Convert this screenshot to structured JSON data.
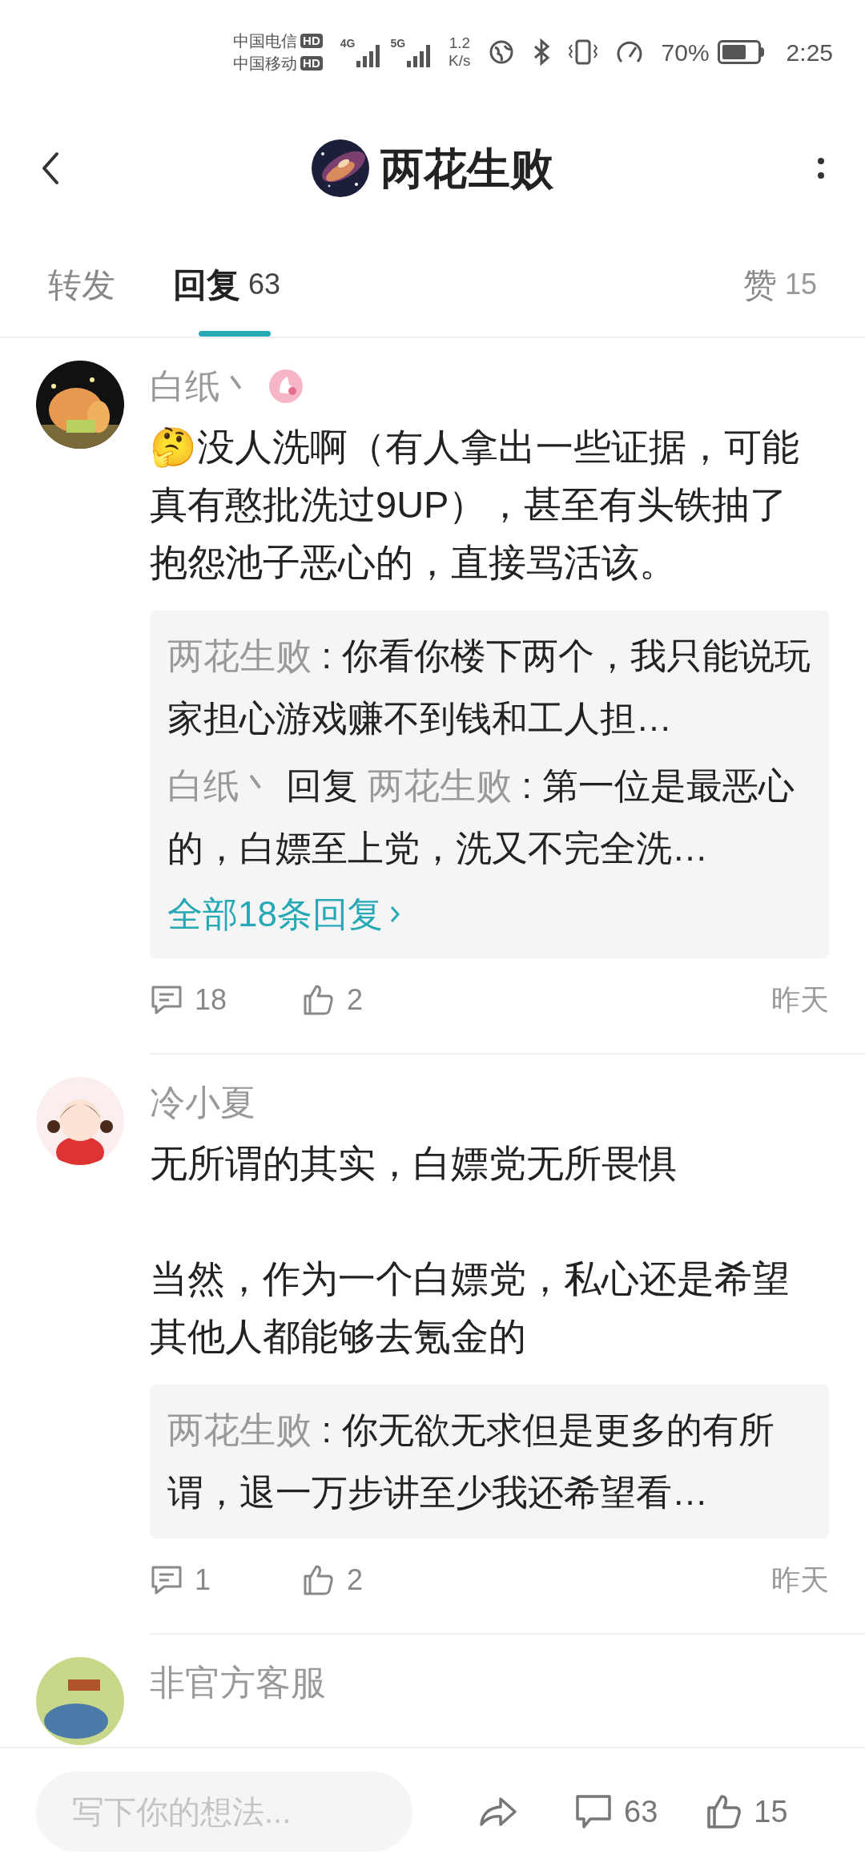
{
  "status_bar": {
    "carriers": [
      {
        "name": "中国电信",
        "badge": "HD"
      },
      {
        "name": "中国移动",
        "badge": "HD"
      }
    ],
    "signals": [
      {
        "label": "4G"
      },
      {
        "label": "5G"
      }
    ],
    "speed": {
      "value": "1.2",
      "unit": "K/s"
    },
    "battery": {
      "text": "70%"
    },
    "time": "2:25"
  },
  "header": {
    "title": "两花生败"
  },
  "tabs": [
    {
      "label": "转发",
      "selected": false
    },
    {
      "label": "回复",
      "count": "63",
      "selected": true
    },
    {
      "label": "赞",
      "count": "15",
      "selected": false
    }
  ],
  "comments": [
    {
      "user": "白纸丶",
      "has_badge": true,
      "paragraphs": [
        "🤔没人洗啊（有人拿出一些证据，可能真有憨批洗过9UP），甚至有头铁抽了抱怨池子恶心的，直接骂活该。"
      ],
      "replies": [
        {
          "author": "两花生败",
          "colon": ":",
          "text": "你看你楼下两个，我只能说玩家担心游戏赚不到钱和工人担…"
        },
        {
          "author": "白纸丶",
          "reply_word": "回复",
          "reply_to": "两花生败",
          "colon": ":",
          "text": "第一位是最恶心的，白嫖至上党，洗又不完全洗…"
        }
      ],
      "more_link": "全部18条回复",
      "reply_count": "18",
      "like_count": "2",
      "time": "昨天"
    },
    {
      "user": "冷小夏",
      "has_badge": false,
      "paragraphs": [
        "无所谓的其实，白嫖党无所畏惧",
        "当然，作为一个白嫖党，私心还是希望其他人都能够去氪金的"
      ],
      "replies": [
        {
          "author": "两花生败",
          "colon": ":",
          "text": "你无欲无求但是更多的有所谓，退一万步讲至少我还希望看…"
        }
      ],
      "reply_count": "1",
      "like_count": "2",
      "time": "昨天"
    },
    {
      "user": "非官方客服",
      "has_badge": false
    }
  ],
  "bottom_bar": {
    "placeholder": "写下你的想法...",
    "comment_count": "63",
    "like_count": "15"
  }
}
